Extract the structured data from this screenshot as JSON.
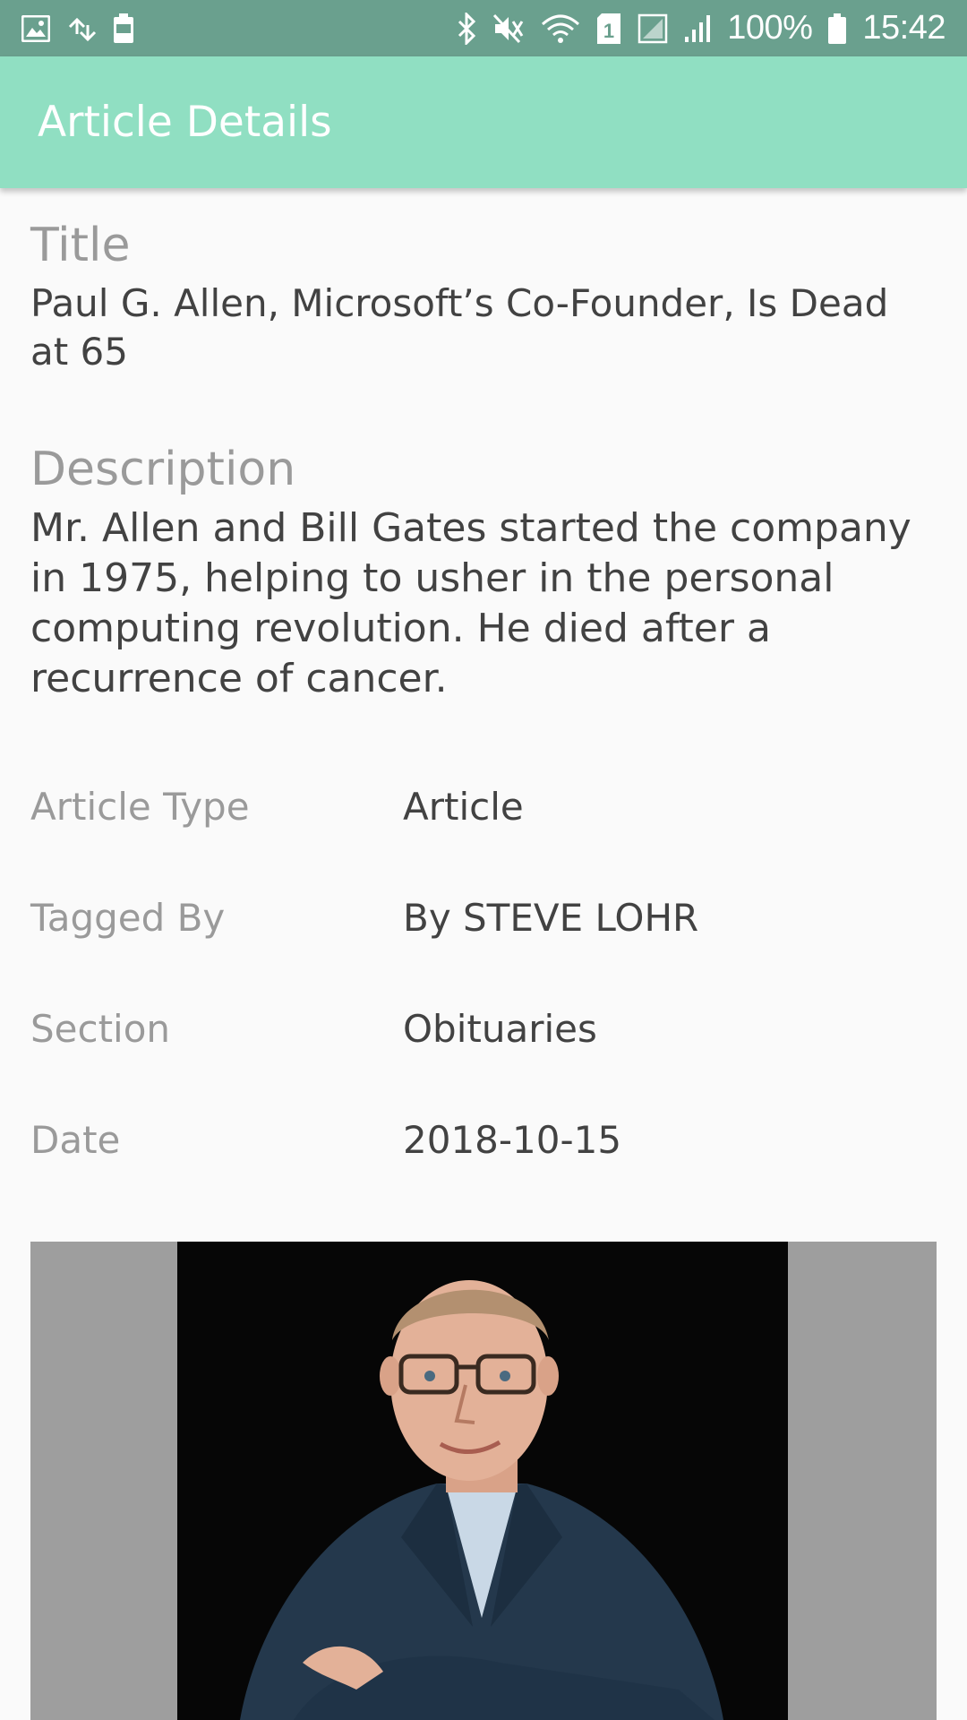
{
  "status_bar": {
    "battery_percent": "100%",
    "time": "15:42",
    "sim_slot": "1",
    "left_icons": [
      "image-icon",
      "transfer-icon",
      "battery-saver-icon"
    ],
    "right_icons": [
      "bluetooth-icon",
      "mute-icon",
      "wifi-icon",
      "sim-icon",
      "signal-icon",
      "signal-bars-icon",
      "battery-icon"
    ]
  },
  "app_bar": {
    "title": "Article Details"
  },
  "article": {
    "title_label": "Title",
    "title": "Paul G. Allen, Microsoft’s Co-Founder, Is Dead at 65",
    "description_label": "Description",
    "description": "Mr. Allen and Bill Gates started the company in 1975, helping to usher in the personal computing revolution. He died after a recurrence of cancer.",
    "meta": [
      {
        "label": "Article Type",
        "value": "Article"
      },
      {
        "label": "Tagged By",
        "value": "By STEVE LOHR"
      },
      {
        "label": "Section",
        "value": "Obituaries"
      },
      {
        "label": "Date",
        "value": "2018-10-15"
      }
    ]
  },
  "colors": {
    "status_bar": "#6aa08e",
    "app_bar": "#90dfc2",
    "background": "#fafafa",
    "label_text": "#9a9a9a",
    "value_text": "#424242"
  }
}
